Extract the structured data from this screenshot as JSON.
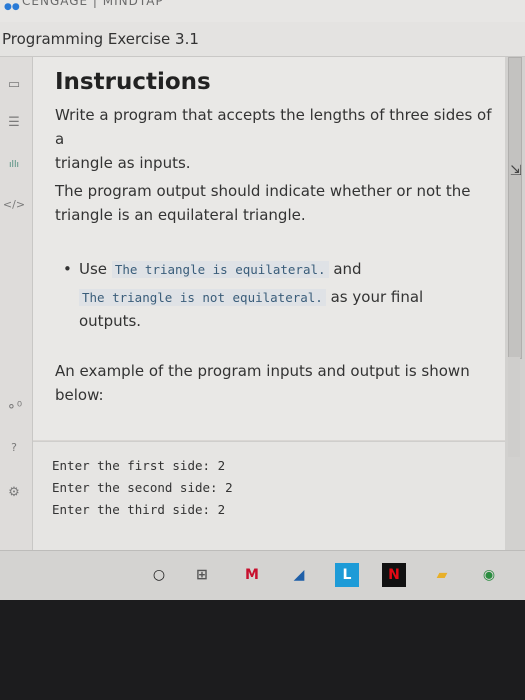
{
  "app": {
    "title": "Programming Exercise 3.1",
    "brand": "CENGAGE | MINDTAP"
  },
  "sidebar": {
    "icons": [
      {
        "name": "book-icon",
        "glyph": "▭"
      },
      {
        "name": "list-icon",
        "glyph": "☰"
      },
      {
        "name": "chart-icon",
        "glyph": "ıllı"
      },
      {
        "name": "code-icon",
        "glyph": "</>"
      },
      {
        "name": "share-icon",
        "glyph": "⚬⁰"
      },
      {
        "name": "help-icon",
        "glyph": "?"
      },
      {
        "name": "settings-icon",
        "glyph": "⚙"
      }
    ]
  },
  "instructions": {
    "heading": "Instructions",
    "para1_line1": "Write a program that accepts the lengths of three sides of a",
    "para1_line2": "triangle as inputs.",
    "para2_line1": "The program output should indicate whether or not the",
    "para2_line2": "triangle is an equilateral triangle.",
    "bullet_use": "Use",
    "bullet_code1": "The triangle is equilateral.",
    "bullet_and": "and",
    "bullet_code2": "The triangle is not equilateral.",
    "bullet_tail": "as your final",
    "bullet_line3": "outputs.",
    "para3_line1": "An example of the program inputs and output is shown",
    "para3_line2": "below:"
  },
  "example": {
    "lines": [
      "Enter the first side: 2",
      "Enter the second side: 2",
      "Enter the third side: 2"
    ]
  },
  "taskbar": {
    "items": [
      {
        "name": "start-circle-icon",
        "glyph": "○",
        "color": "#222222"
      },
      {
        "name": "task-view-icon",
        "glyph": "⊞",
        "color": "#555555"
      },
      {
        "name": "mcafee-icon",
        "glyph": "M",
        "color": "#c8102e"
      },
      {
        "name": "wifi-app-icon",
        "glyph": "◢",
        "color": "#1f5fa8"
      },
      {
        "name": "l-app-icon",
        "glyph": "L",
        "color": "#1e9bd7"
      },
      {
        "name": "netflix-icon",
        "glyph": "N",
        "color": "#e50914"
      },
      {
        "name": "file-explorer-icon",
        "glyph": "▰",
        "color": "#e8b02a"
      },
      {
        "name": "chrome-icon",
        "glyph": "◉",
        "color": "#2a8d3f"
      }
    ]
  }
}
